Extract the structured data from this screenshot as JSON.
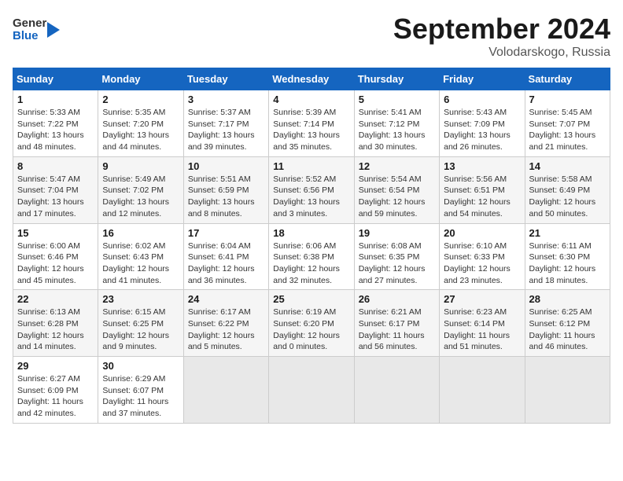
{
  "header": {
    "logo_general": "General",
    "logo_blue": "Blue",
    "month": "September 2024",
    "location": "Volodarskogo, Russia"
  },
  "weekdays": [
    "Sunday",
    "Monday",
    "Tuesday",
    "Wednesday",
    "Thursday",
    "Friday",
    "Saturday"
  ],
  "weeks": [
    [
      {
        "day": "1",
        "sunrise": "5:33 AM",
        "sunset": "7:22 PM",
        "daylight": "13 hours and 48 minutes."
      },
      {
        "day": "2",
        "sunrise": "5:35 AM",
        "sunset": "7:20 PM",
        "daylight": "13 hours and 44 minutes."
      },
      {
        "day": "3",
        "sunrise": "5:37 AM",
        "sunset": "7:17 PM",
        "daylight": "13 hours and 39 minutes."
      },
      {
        "day": "4",
        "sunrise": "5:39 AM",
        "sunset": "7:14 PM",
        "daylight": "13 hours and 35 minutes."
      },
      {
        "day": "5",
        "sunrise": "5:41 AM",
        "sunset": "7:12 PM",
        "daylight": "13 hours and 30 minutes."
      },
      {
        "day": "6",
        "sunrise": "5:43 AM",
        "sunset": "7:09 PM",
        "daylight": "13 hours and 26 minutes."
      },
      {
        "day": "7",
        "sunrise": "5:45 AM",
        "sunset": "7:07 PM",
        "daylight": "13 hours and 21 minutes."
      }
    ],
    [
      {
        "day": "8",
        "sunrise": "5:47 AM",
        "sunset": "7:04 PM",
        "daylight": "13 hours and 17 minutes."
      },
      {
        "day": "9",
        "sunrise": "5:49 AM",
        "sunset": "7:02 PM",
        "daylight": "13 hours and 12 minutes."
      },
      {
        "day": "10",
        "sunrise": "5:51 AM",
        "sunset": "6:59 PM",
        "daylight": "13 hours and 8 minutes."
      },
      {
        "day": "11",
        "sunrise": "5:52 AM",
        "sunset": "6:56 PM",
        "daylight": "13 hours and 3 minutes."
      },
      {
        "day": "12",
        "sunrise": "5:54 AM",
        "sunset": "6:54 PM",
        "daylight": "12 hours and 59 minutes."
      },
      {
        "day": "13",
        "sunrise": "5:56 AM",
        "sunset": "6:51 PM",
        "daylight": "12 hours and 54 minutes."
      },
      {
        "day": "14",
        "sunrise": "5:58 AM",
        "sunset": "6:49 PM",
        "daylight": "12 hours and 50 minutes."
      }
    ],
    [
      {
        "day": "15",
        "sunrise": "6:00 AM",
        "sunset": "6:46 PM",
        "daylight": "12 hours and 45 minutes."
      },
      {
        "day": "16",
        "sunrise": "6:02 AM",
        "sunset": "6:43 PM",
        "daylight": "12 hours and 41 minutes."
      },
      {
        "day": "17",
        "sunrise": "6:04 AM",
        "sunset": "6:41 PM",
        "daylight": "12 hours and 36 minutes."
      },
      {
        "day": "18",
        "sunrise": "6:06 AM",
        "sunset": "6:38 PM",
        "daylight": "12 hours and 32 minutes."
      },
      {
        "day": "19",
        "sunrise": "6:08 AM",
        "sunset": "6:35 PM",
        "daylight": "12 hours and 27 minutes."
      },
      {
        "day": "20",
        "sunrise": "6:10 AM",
        "sunset": "6:33 PM",
        "daylight": "12 hours and 23 minutes."
      },
      {
        "day": "21",
        "sunrise": "6:11 AM",
        "sunset": "6:30 PM",
        "daylight": "12 hours and 18 minutes."
      }
    ],
    [
      {
        "day": "22",
        "sunrise": "6:13 AM",
        "sunset": "6:28 PM",
        "daylight": "12 hours and 14 minutes."
      },
      {
        "day": "23",
        "sunrise": "6:15 AM",
        "sunset": "6:25 PM",
        "daylight": "12 hours and 9 minutes."
      },
      {
        "day": "24",
        "sunrise": "6:17 AM",
        "sunset": "6:22 PM",
        "daylight": "12 hours and 5 minutes."
      },
      {
        "day": "25",
        "sunrise": "6:19 AM",
        "sunset": "6:20 PM",
        "daylight": "12 hours and 0 minutes."
      },
      {
        "day": "26",
        "sunrise": "6:21 AM",
        "sunset": "6:17 PM",
        "daylight": "11 hours and 56 minutes."
      },
      {
        "day": "27",
        "sunrise": "6:23 AM",
        "sunset": "6:14 PM",
        "daylight": "11 hours and 51 minutes."
      },
      {
        "day": "28",
        "sunrise": "6:25 AM",
        "sunset": "6:12 PM",
        "daylight": "11 hours and 46 minutes."
      }
    ],
    [
      {
        "day": "29",
        "sunrise": "6:27 AM",
        "sunset": "6:09 PM",
        "daylight": "11 hours and 42 minutes."
      },
      {
        "day": "30",
        "sunrise": "6:29 AM",
        "sunset": "6:07 PM",
        "daylight": "11 hours and 37 minutes."
      },
      {
        "day": "",
        "sunrise": "",
        "sunset": "",
        "daylight": ""
      },
      {
        "day": "",
        "sunrise": "",
        "sunset": "",
        "daylight": ""
      },
      {
        "day": "",
        "sunrise": "",
        "sunset": "",
        "daylight": ""
      },
      {
        "day": "",
        "sunrise": "",
        "sunset": "",
        "daylight": ""
      },
      {
        "day": "",
        "sunrise": "",
        "sunset": "",
        "daylight": ""
      }
    ]
  ],
  "labels": {
    "sunrise": "Sunrise:",
    "sunset": "Sunset:",
    "daylight": "Daylight:"
  }
}
